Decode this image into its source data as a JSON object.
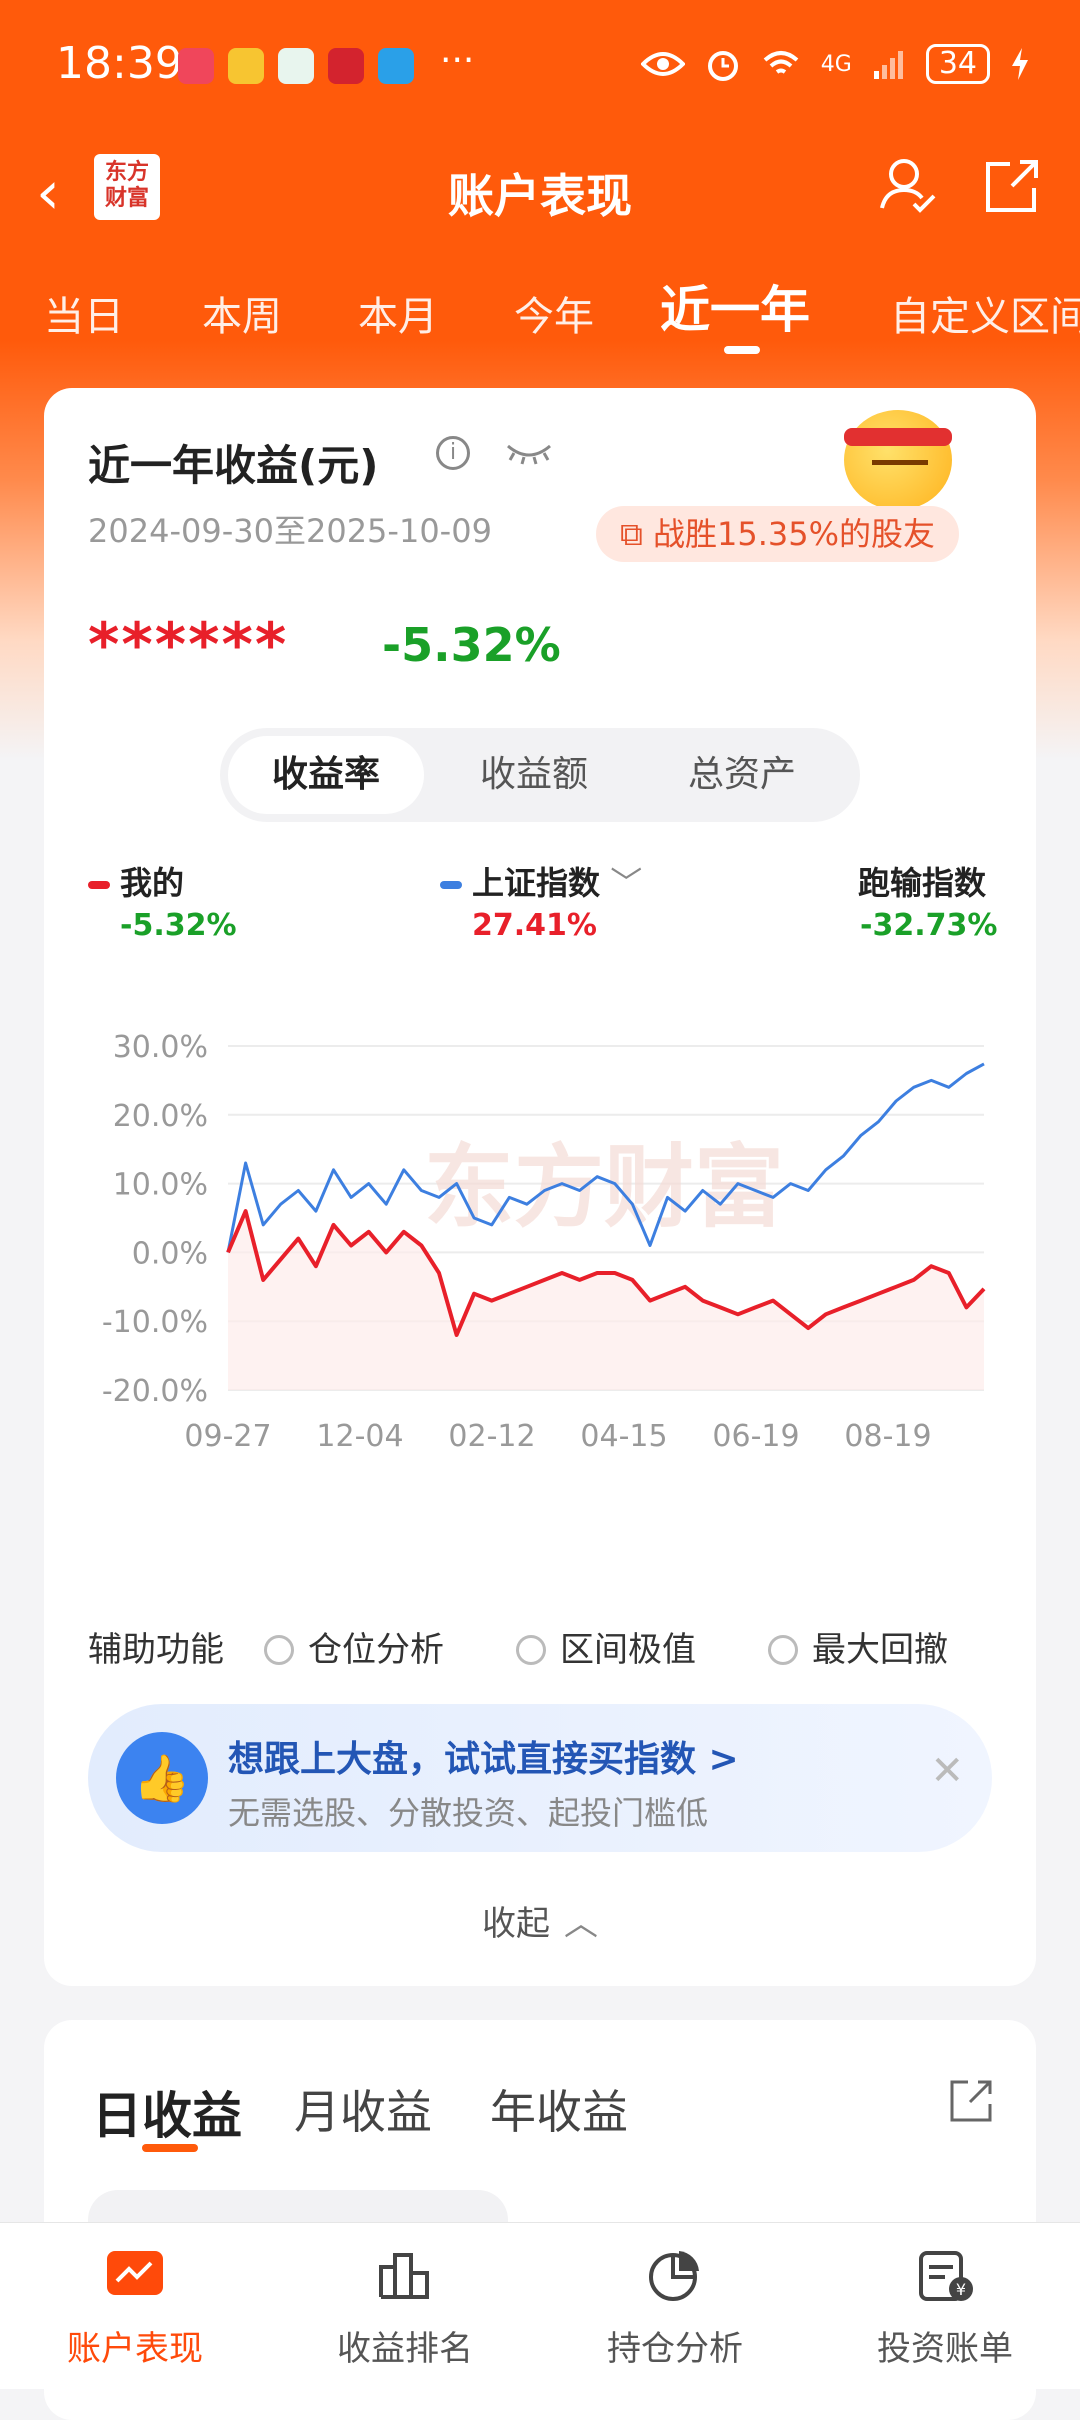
{
  "status": {
    "time": "18:39",
    "more": "···",
    "battery": "34",
    "network": "4G"
  },
  "nav": {
    "title": "账户表现",
    "logo_line1": "东方",
    "logo_line2": "财富"
  },
  "tabs": [
    "当日",
    "本周",
    "本月",
    "今年",
    "近一年",
    "自定义区间"
  ],
  "active_tab": "近一年",
  "card": {
    "title": "近一年收益(元)",
    "range": "2024-09-30至2025-10-09",
    "badge": "战胜15.35%的股友",
    "masked_amount": "******",
    "return_pct": "-5.32%",
    "segments": [
      "收益率",
      "收益额",
      "总资产"
    ],
    "active_segment": "收益率",
    "legend": [
      {
        "label": "我的",
        "value": "-5.32%",
        "color": "#e8202a",
        "value_color": "#1aa028"
      },
      {
        "label": "上证指数",
        "value": "27.41%",
        "color": "#3d7fe0",
        "value_color": "#e8202a"
      },
      {
        "label": "跑输指数",
        "value": "-32.73%",
        "color": "",
        "value_color": "#1aa028"
      }
    ],
    "aux_label": "辅助功能",
    "aux_options": [
      "仓位分析",
      "区间极值",
      "最大回撤"
    ],
    "promo_title": "想跟上大盘，试试直接买指数 >",
    "promo_sub": "无需选股、分散投资、起投门槛低",
    "collapse_label": "收起"
  },
  "chart_data": {
    "type": "line",
    "y_ticks": [
      "30.0%",
      "20.0%",
      "10.0%",
      "0.0%",
      "-10.0%",
      "-20.0%"
    ],
    "ylim": [
      -20,
      30
    ],
    "x_ticks": [
      "09-27",
      "12-04",
      "02-12",
      "04-15",
      "06-19",
      "08-19"
    ],
    "watermark": "东方财富",
    "series": [
      {
        "name": "上证指数",
        "color": "#3d7fe0",
        "values": [
          0,
          13,
          4,
          7,
          9,
          6,
          12,
          8,
          10,
          7,
          12,
          9,
          8,
          10,
          5,
          4,
          8,
          7,
          9,
          10,
          9,
          11,
          10,
          7,
          1,
          8,
          6,
          9,
          7,
          10,
          9,
          8,
          10,
          9,
          12,
          14,
          17,
          19,
          22,
          24,
          25,
          24,
          26,
          27.4
        ]
      },
      {
        "name": "我的",
        "color": "#e8202a",
        "values": [
          0,
          6,
          -4,
          -1,
          2,
          -2,
          4,
          1,
          3,
          0,
          3,
          1,
          -3,
          -12,
          -6,
          -7,
          -6,
          -5,
          -4,
          -3,
          -4,
          -3,
          -3,
          -4,
          -7,
          -6,
          -5,
          -7,
          -8,
          -9,
          -8,
          -7,
          -9,
          -11,
          -9,
          -8,
          -7,
          -6,
          -5,
          -4,
          -2,
          -3,
          -8,
          -5.3
        ]
      }
    ]
  },
  "section2": {
    "tabs": [
      "日收益",
      "月收益",
      "年收益"
    ],
    "active": "日收益"
  },
  "bottom_nav": [
    {
      "label": "账户表现",
      "icon": "chart-card-icon",
      "active": true
    },
    {
      "label": "收益排名",
      "icon": "bar-chart-icon",
      "active": false
    },
    {
      "label": "持仓分析",
      "icon": "pie-chart-icon",
      "active": false
    },
    {
      "label": "投资账单",
      "icon": "bill-icon",
      "active": false
    }
  ]
}
